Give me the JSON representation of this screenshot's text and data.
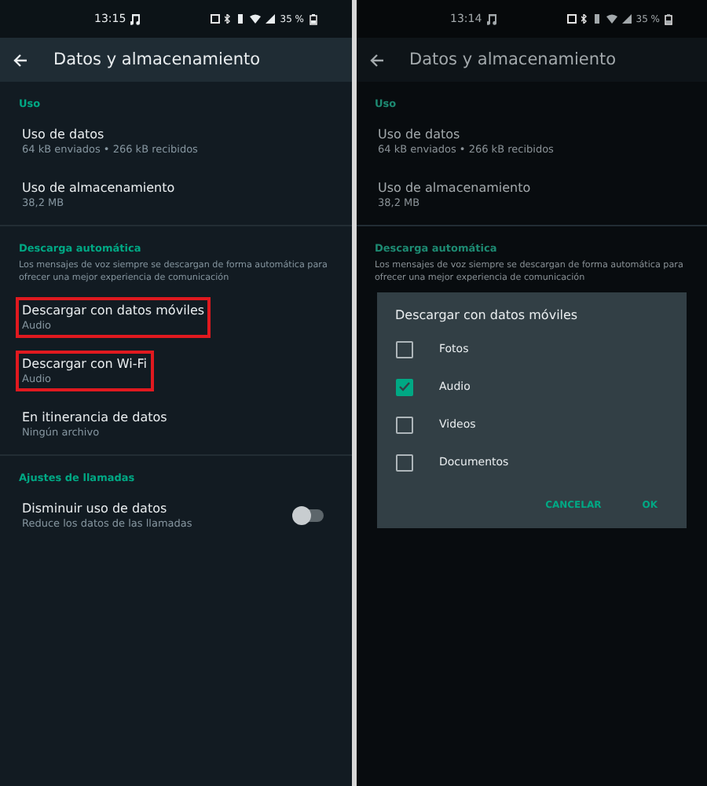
{
  "screens": [
    {
      "time": "13:15",
      "battery": "35 %",
      "title": "Datos y almacenamiento",
      "dimmed": false,
      "sections": [
        {
          "heading": "Uso",
          "items": [
            {
              "kind": "row",
              "title": "Uso de datos",
              "subtitle": "64 kB enviados • 266 kB recibidos",
              "highlighted": false
            },
            {
              "kind": "row",
              "title": "Uso de almacenamiento",
              "subtitle": "38,2 MB",
              "highlighted": false
            }
          ]
        },
        {
          "heading": "Descarga automática",
          "description": "Los mensajes de voz siempre se descargan de forma automática para ofrecer una mejor experiencia de comunicación",
          "items": [
            {
              "kind": "row",
              "title": "Descargar con datos móviles",
              "subtitle": "Audio",
              "highlighted": true
            },
            {
              "kind": "row",
              "title": "Descargar con Wi-Fi",
              "subtitle": "Audio",
              "highlighted": true
            },
            {
              "kind": "row",
              "title": "En itinerancia de datos",
              "subtitle": "Ningún archivo",
              "highlighted": false
            }
          ]
        },
        {
          "heading": "Ajustes de llamadas",
          "items": [
            {
              "kind": "toggle",
              "title": "Disminuir uso de datos",
              "subtitle": "Reduce los datos de las llamadas",
              "highlighted": false,
              "on": false
            }
          ]
        }
      ]
    },
    {
      "time": "13:14",
      "battery": "35 %",
      "title": "Datos y almacenamiento",
      "dimmed": true,
      "sections": [
        {
          "heading": "Uso",
          "items": [
            {
              "kind": "row",
              "title": "Uso de datos",
              "subtitle": "64 kB enviados • 266 kB recibidos",
              "highlighted": false
            },
            {
              "kind": "row",
              "title": "Uso de almacenamiento",
              "subtitle": "38,2 MB",
              "highlighted": false
            }
          ]
        },
        {
          "heading": "Descarga automática",
          "description": "Los mensajes de voz siempre se descargan de forma automática para ofrecer una mejor experiencia de comunicación"
        }
      ],
      "dialog": {
        "title": "Descargar con datos móviles",
        "options": [
          {
            "label": "Fotos",
            "checked": false
          },
          {
            "label": "Audio",
            "checked": true
          },
          {
            "label": "Videos",
            "checked": false
          },
          {
            "label": "Documentos",
            "checked": false
          }
        ],
        "buttons": [
          "CANCELAR",
          "OK"
        ]
      }
    }
  ]
}
